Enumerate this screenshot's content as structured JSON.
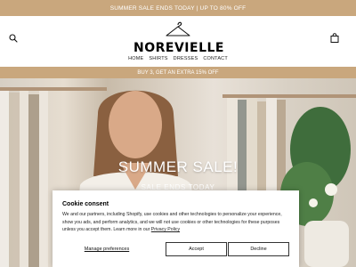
{
  "promo_bar": {
    "text": "SUMMER SALE ENDS TODAY | UP TO 80% OFF"
  },
  "header": {
    "logo_text": "NOREVIELLE",
    "nav": [
      "HOME",
      "SHIRTS",
      "DRESSES",
      "CONTACT"
    ],
    "icons": [
      "search-icon",
      "bag-icon",
      "hanger-icon"
    ]
  },
  "offer_bar": {
    "text": "BUY 3, GET AN EXTRA 15% OFF"
  },
  "hero": {
    "title": "SUMMER SALE!",
    "subtitle": "SALE ENDS TODAY"
  },
  "cookie": {
    "title": "Cookie consent",
    "body": "We and our partners, including Shopify, use cookies and other technologies to personalize your experience, show you ads, and perform analytics, and we will not use cookies or other technologies for these purposes unless you accept them. Learn more in our ",
    "policy_link": "Privacy Policy",
    "manage_label": "Manage preferences",
    "accept_label": "Accept",
    "decline_label": "Decline"
  },
  "colors": {
    "accent": "#c9a77d",
    "text": "#111111",
    "background": "#ffffff"
  }
}
